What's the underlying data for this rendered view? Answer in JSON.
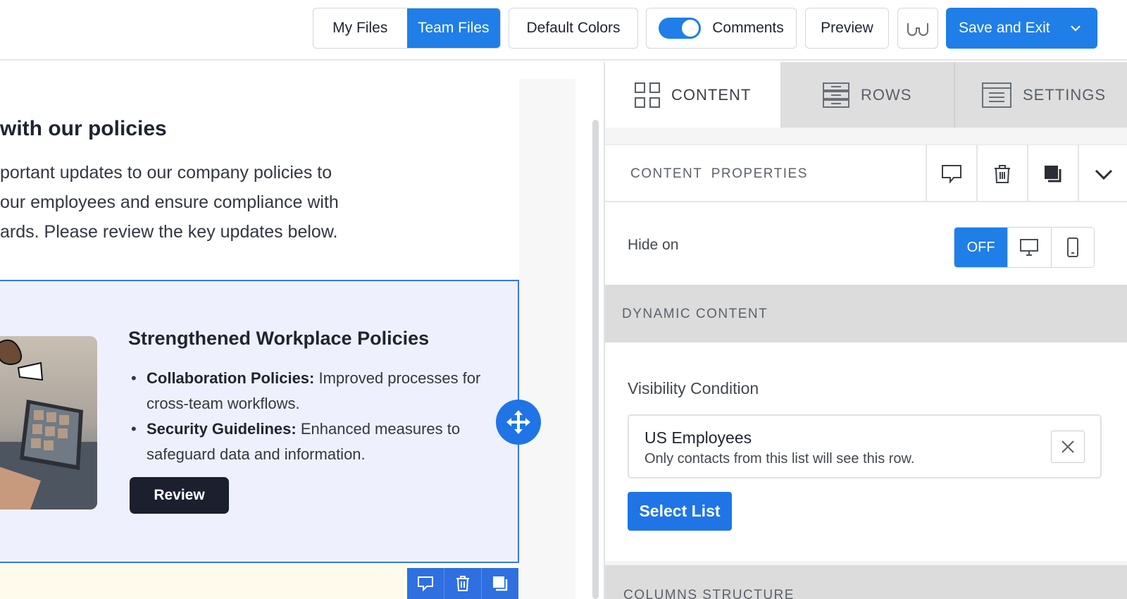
{
  "topbar": {
    "my_files": "My Files",
    "team_files": "Team Files",
    "default_colors": "Default Colors",
    "comments": "Comments",
    "comments_enabled": true,
    "preview": "Preview",
    "save_and_exit": "Save and Exit"
  },
  "canvas": {
    "heading": "with our policies",
    "para_lines": [
      "portant updates to our company policies to",
      "our employees and ensure compliance with",
      "ards. Please review the key updates below."
    ],
    "card": {
      "title": "Strengthened Workplace Policies",
      "bullets": [
        {
          "bold": "Collaboration Policies:",
          "text": " Improved processes for cross-team workflows."
        },
        {
          "bold": "Security Guidelines:",
          "text": " Enhanced measures to safeguard data and information."
        }
      ],
      "button": "Review"
    }
  },
  "panel": {
    "tabs": [
      "CONTENT",
      "ROWS",
      "SETTINGS"
    ],
    "active_tab": "CONTENT",
    "content_properties": "CONTENT  PROPERTIES",
    "hide_on": {
      "label": "Hide on",
      "off": "OFF"
    },
    "dynamic_content": "DYNAMIC CONTENT",
    "visibility": {
      "label": "Visibility Condition",
      "list_name": "US Employees",
      "list_desc": "Only contacts from this list will see this row.",
      "select_button": "Select List"
    },
    "columns_structure": "COLUMNS STRUCTURE"
  },
  "colors": {
    "accent": "#1f7ee8",
    "row_border": "#3777e6",
    "row_bg": "#eef1fd",
    "dark_button": "#1b1f2e"
  }
}
